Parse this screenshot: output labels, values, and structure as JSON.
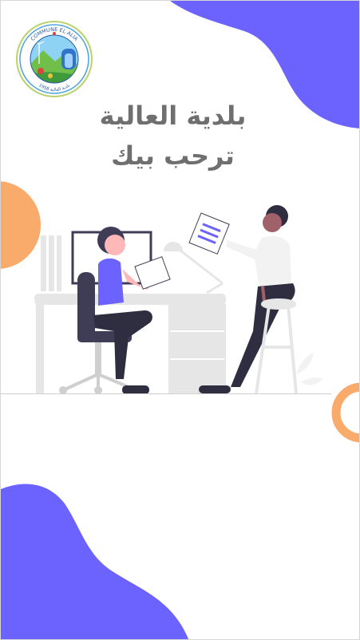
{
  "logo": {
    "text_top": "COMMUNE EL ALIA",
    "text_bottom": "بلدية العالية 1958"
  },
  "headline": {
    "line1": "بلدية العالية",
    "line2": "ترحب بيك"
  },
  "colors": {
    "primary_blob": "#6c63ff",
    "accent_orange": "#f8ab6b",
    "title_text": "#6f6f6f",
    "divider": "#cfcfcf"
  },
  "illustration": {
    "name": "team-working-desk",
    "icon": "office-collaboration-illustration"
  }
}
